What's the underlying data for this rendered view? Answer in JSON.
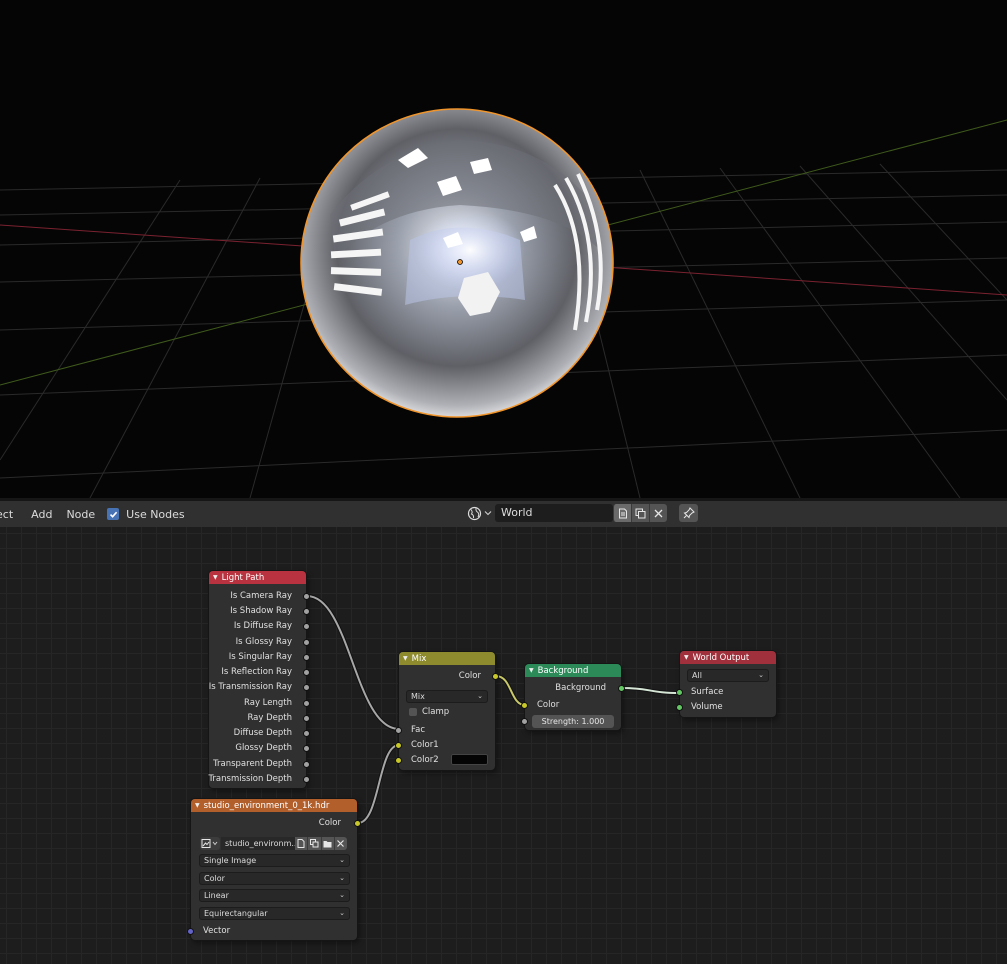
{
  "header": {
    "menu_select": "ect",
    "menu_add": "Add",
    "menu_node": "Node",
    "use_nodes_label": "Use Nodes",
    "world_name": "World"
  },
  "nodes": {
    "light_path": {
      "title": "Light Path",
      "outputs": [
        "Is Camera Ray",
        "Is Shadow Ray",
        "Is Diffuse Ray",
        "Is Glossy Ray",
        "Is Singular Ray",
        "Is Reflection Ray",
        "Is Transmission Ray",
        "Ray Length",
        "Ray Depth",
        "Diffuse Depth",
        "Glossy Depth",
        "Transparent Depth",
        "Transmission Depth"
      ]
    },
    "env_texture": {
      "title": "studio_environment_0_1k.hdr",
      "output": "Color",
      "image_name": "studio_environm...",
      "source": "Single Image",
      "color_space": "Color",
      "interpolation": "Linear",
      "projection": "Equirectangular",
      "input": "Vector"
    },
    "mix": {
      "title": "Mix",
      "output": "Color",
      "blend_type": "Mix",
      "clamp": "Clamp",
      "inputs": [
        "Fac",
        "Color1",
        "Color2"
      ]
    },
    "background": {
      "title": "Background",
      "output": "Background",
      "input_color": "Color",
      "strength": "Strength: 1.000"
    },
    "world_output": {
      "title": "World Output",
      "target": "All",
      "inputs": [
        "Surface",
        "Volume"
      ]
    }
  },
  "colors": {
    "input_header": "#b8333f",
    "texture_header": "#b35f2c",
    "converter_header": "#8d8b2e",
    "shader_header": "#2c8a59",
    "output_header": "#a0303c",
    "selection_outline": "#f0952c"
  }
}
